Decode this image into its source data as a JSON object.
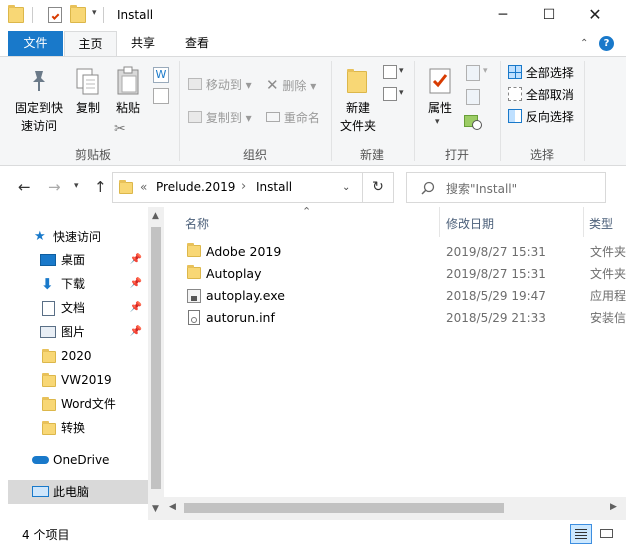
{
  "window": {
    "title": "Install"
  },
  "ribbon_tabs": [
    {
      "label": "文件"
    },
    {
      "label": "主页"
    },
    {
      "label": "共享"
    },
    {
      "label": "查看"
    }
  ],
  "ribbon": {
    "clipboard": {
      "pin_label_1": "固定到快",
      "pin_label_2": "速访问",
      "copy_label": "复制",
      "paste_label": "粘贴",
      "group_label": "剪贴板"
    },
    "organize": {
      "move_to": "移动到",
      "copy_to": "复制到",
      "delete": "删除",
      "rename": "重命名",
      "group_label": "组织"
    },
    "new": {
      "new_folder_1": "新建",
      "new_folder_2": "文件夹",
      "group_label": "新建"
    },
    "open": {
      "properties": "属性",
      "group_label": "打开"
    },
    "select": {
      "select_all": "全部选择",
      "select_none": "全部取消",
      "invert": "反向选择",
      "group_label": "选择"
    }
  },
  "address": {
    "chevrons": "«",
    "crumbs": [
      "Prelude.2019",
      "Install"
    ],
    "separator": "›"
  },
  "search": {
    "placeholder": "搜索\"Install\""
  },
  "nav": {
    "items": [
      {
        "label": "快速访问",
        "icon": "star-icon"
      },
      {
        "label": "桌面",
        "icon": "desktop-icon",
        "pinned": true
      },
      {
        "label": "下载",
        "icon": "download-icon",
        "pinned": true
      },
      {
        "label": "文档",
        "icon": "document-icon",
        "pinned": true
      },
      {
        "label": "图片",
        "icon": "picture-icon",
        "pinned": true
      },
      {
        "label": "2020",
        "icon": "folder-icon"
      },
      {
        "label": "VW2019",
        "icon": "folder-icon"
      },
      {
        "label": "Word文件",
        "icon": "folder-icon"
      },
      {
        "label": "转换",
        "icon": "folder-icon"
      },
      {
        "label": "OneDrive",
        "icon": "cloud-icon"
      },
      {
        "label": "此电脑",
        "icon": "computer-icon",
        "selected": true
      }
    ]
  },
  "files": {
    "columns": [
      "名称",
      "修改日期",
      "类型"
    ],
    "rows": [
      {
        "name": "Adobe 2019",
        "date": "2019/8/27 15:31",
        "type": "文件夹",
        "icon": "folder-icon"
      },
      {
        "name": "Autoplay",
        "date": "2019/8/27 15:31",
        "type": "文件夹",
        "icon": "folder-icon"
      },
      {
        "name": "autoplay.exe",
        "date": "2018/5/29 19:47",
        "type": "应用程序",
        "icon": "exe-icon"
      },
      {
        "name": "autorun.inf",
        "date": "2018/5/29 21:33",
        "type": "安装信息",
        "icon": "inf-icon"
      }
    ]
  },
  "status": {
    "count": "4 个项目"
  },
  "colors": {
    "accent": "#1979ca",
    "folder": "#f8d775",
    "selected": "#cce8ff"
  }
}
